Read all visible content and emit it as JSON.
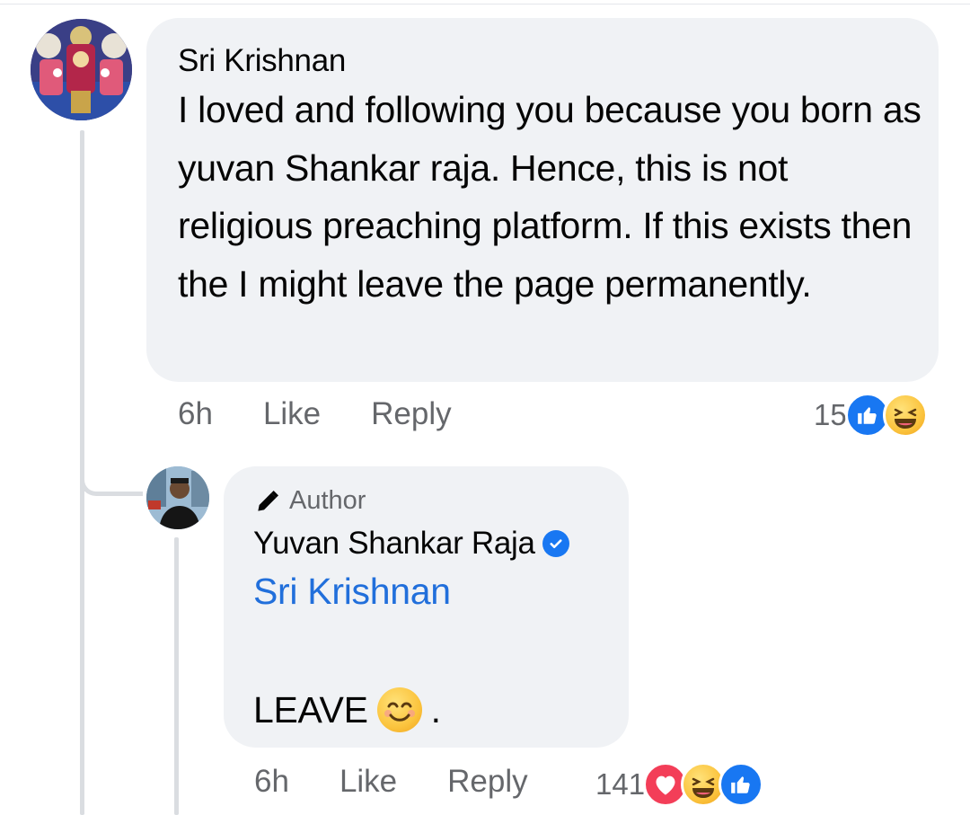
{
  "comment": {
    "author": "Sri Krishnan",
    "text": "I loved and following you because you born as yuvan Shankar raja. Hence, this is not religious preaching platform. If this exists then the I might leave the page permanently.",
    "time": "6h",
    "like_label": "Like",
    "reply_label": "Reply",
    "reaction_count": "15",
    "reactions": [
      "like-icon",
      "haha-icon"
    ]
  },
  "reply": {
    "badge": "Author",
    "author": "Yuvan Shankar Raja",
    "verified": true,
    "mention": "Sri Krishnan",
    "text": "LEAVE",
    "trailing": ".",
    "emoji": "smiling-face-icon",
    "time": "6h",
    "like_label": "Like",
    "reply_label": "Reply",
    "reaction_count": "141",
    "reactions": [
      "love-icon",
      "haha-icon",
      "like-icon"
    ]
  },
  "colors": {
    "bubble": "#f0f2f5",
    "link": "#216fdb",
    "meta": "#65676b",
    "like": "#1877f2",
    "love": "#f33e58",
    "haha": "#fbc43e"
  }
}
